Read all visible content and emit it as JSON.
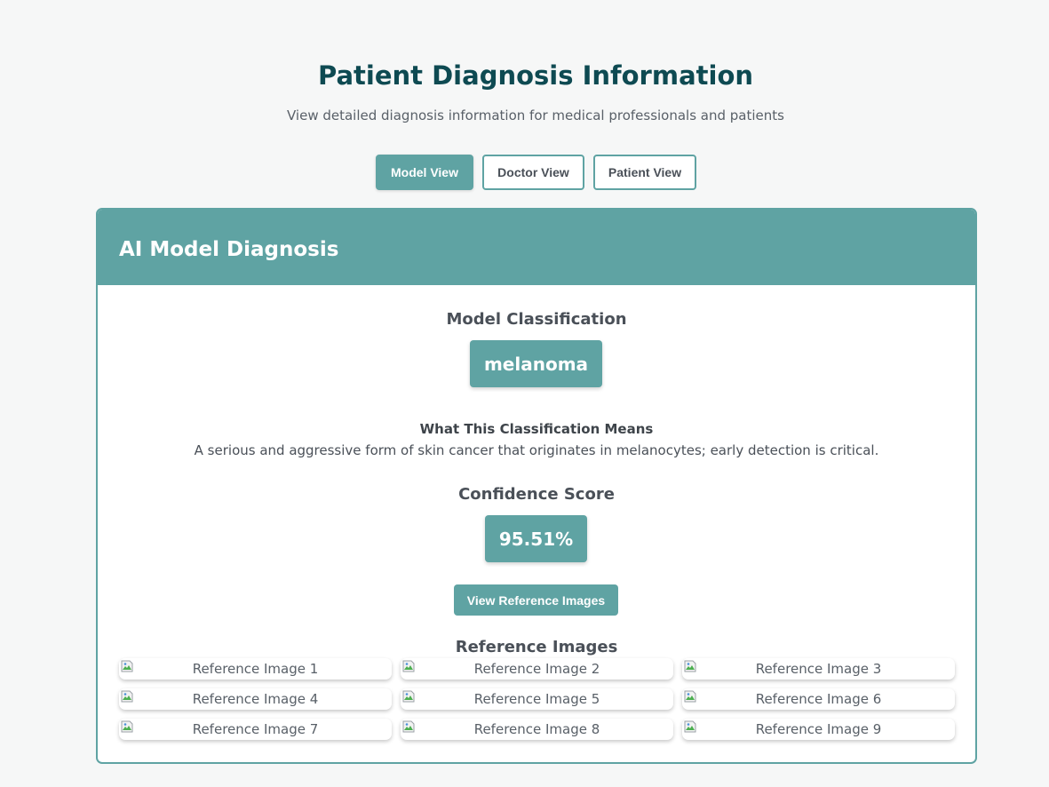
{
  "header": {
    "title": "Patient Diagnosis Information",
    "subtitle": "View detailed diagnosis information for medical professionals and patients"
  },
  "tabs": [
    {
      "label": "Model View",
      "active": true
    },
    {
      "label": "Doctor View",
      "active": false
    },
    {
      "label": "Patient View",
      "active": false
    }
  ],
  "card": {
    "title": "AI Model Diagnosis",
    "classification_heading": "Model Classification",
    "classification": "melanoma",
    "meaning_heading": "What This Classification Means",
    "meaning_text": "A serious and aggressive form of skin cancer that originates in melanocytes; early detection is critical.",
    "confidence_heading": "Confidence Score",
    "confidence": "95.51%",
    "reference_button": "View Reference Images",
    "reference_heading": "Reference Images",
    "reference_images": [
      "Reference Image 1",
      "Reference Image 2",
      "Reference Image 3",
      "Reference Image 4",
      "Reference Image 5",
      "Reference Image 6",
      "Reference Image 7",
      "Reference Image 8",
      "Reference Image 9"
    ]
  },
  "colors": {
    "accent": "#5fa3a3",
    "title": "#0e4a52",
    "text": "#4a5058",
    "background": "#f6f7f7"
  },
  "icons": {
    "reference_image": "broken-image-icon"
  }
}
